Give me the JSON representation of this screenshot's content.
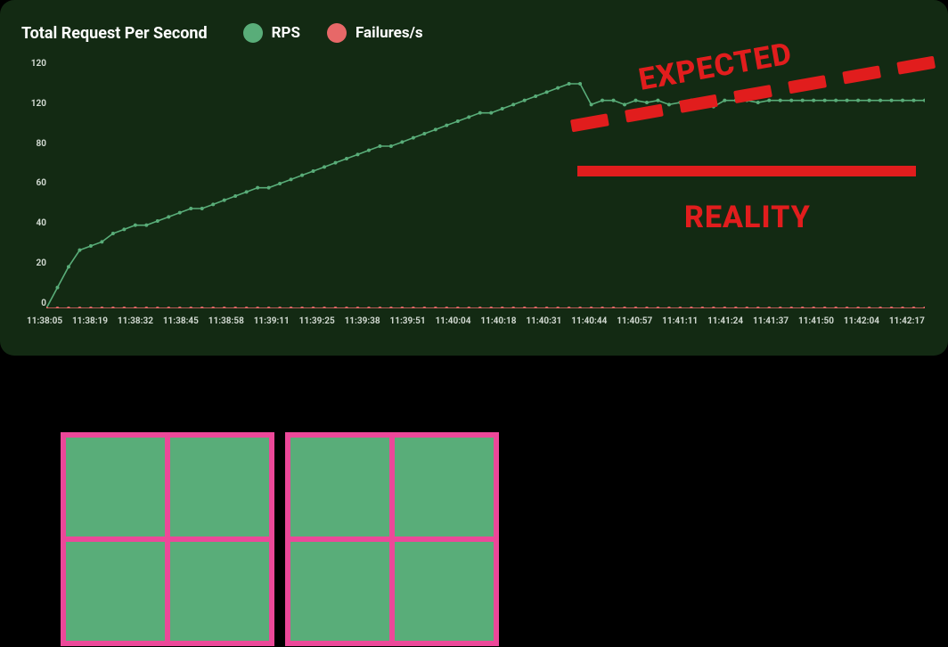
{
  "chart_data": {
    "type": "line",
    "title": "Total Request Per Second",
    "ylabel": "",
    "xlabel": "",
    "ylim": [
      0,
      120
    ],
    "x": [
      "11:38:05",
      "11:38:19",
      "11:38:32",
      "11:38:45",
      "11:38:58",
      "11:39:11",
      "11:39:25",
      "11:39:38",
      "11:39:51",
      "11:40:04",
      "11:40:18",
      "11:40:31",
      "11:40:44",
      "11:40:57",
      "11:41:11",
      "11:41:24",
      "11:41:37",
      "11:41:50",
      "11:42:04",
      "11:42:17"
    ],
    "series": [
      {
        "name": "RPS",
        "color": "#59ad79",
        "values": [
          0,
          10,
          20,
          28,
          30,
          32,
          36,
          38,
          40,
          40,
          42,
          44,
          46,
          48,
          48,
          50,
          52,
          54,
          56,
          58,
          58,
          60,
          62,
          64,
          66,
          68,
          70,
          72,
          74,
          76,
          78,
          78,
          80,
          82,
          84,
          86,
          88,
          90,
          92,
          94,
          94,
          96,
          98,
          100,
          102,
          104,
          106,
          108,
          108,
          98,
          100,
          100,
          98,
          100,
          99,
          100,
          98,
          99,
          100,
          100,
          97,
          100,
          100,
          100,
          99,
          100,
          100,
          100,
          100,
          100,
          100,
          100,
          100,
          100,
          100,
          100,
          100,
          100,
          100,
          100
        ]
      },
      {
        "name": "Failures/s",
        "color": "#e76868",
        "values": [
          0,
          0,
          0,
          0,
          0,
          0,
          0,
          0,
          0,
          0,
          0,
          0,
          0,
          0,
          0,
          0,
          0,
          0,
          0,
          0,
          0,
          0,
          0,
          0,
          0,
          0,
          0,
          0,
          0,
          0,
          0,
          0,
          0,
          0,
          0,
          0,
          0,
          0,
          0,
          0,
          0,
          0,
          0,
          0,
          0,
          0,
          0,
          0,
          0,
          0,
          0,
          0,
          0,
          0,
          0,
          0,
          0,
          0,
          0,
          0,
          0,
          0,
          0,
          0,
          0,
          0,
          0,
          0,
          0,
          0,
          0,
          0,
          0,
          0,
          0,
          0,
          0,
          0,
          0,
          0
        ]
      }
    ],
    "y_ticks": [
      120,
      120,
      80,
      60,
      40,
      20,
      0
    ],
    "x_ticks": [
      "11:38:05",
      "11:38:19",
      "11:38:32",
      "11:38:45",
      "11:38:58",
      "11:39:11",
      "11:39:25",
      "11:39:38",
      "11:39:51",
      "11:40:04",
      "11:40:18",
      "11:40:31",
      "11:40:44",
      "11:40:57",
      "11:41:11",
      "11:41:24",
      "11:41:37",
      "11:41:50",
      "11:42:04",
      "11:42:17"
    ]
  },
  "annotations": {
    "expected": "EXPECTED",
    "reality": "REALITY"
  },
  "legend": {
    "rps": "RPS",
    "failures": "Failures/s"
  },
  "colors": {
    "panel_bg": "#132a13",
    "green": "#59ad79",
    "red_soft": "#e76868",
    "red_bold": "#e11d1d",
    "pink": "#ec4899"
  },
  "cores": {
    "count": 2,
    "cells_per_core": 4
  }
}
